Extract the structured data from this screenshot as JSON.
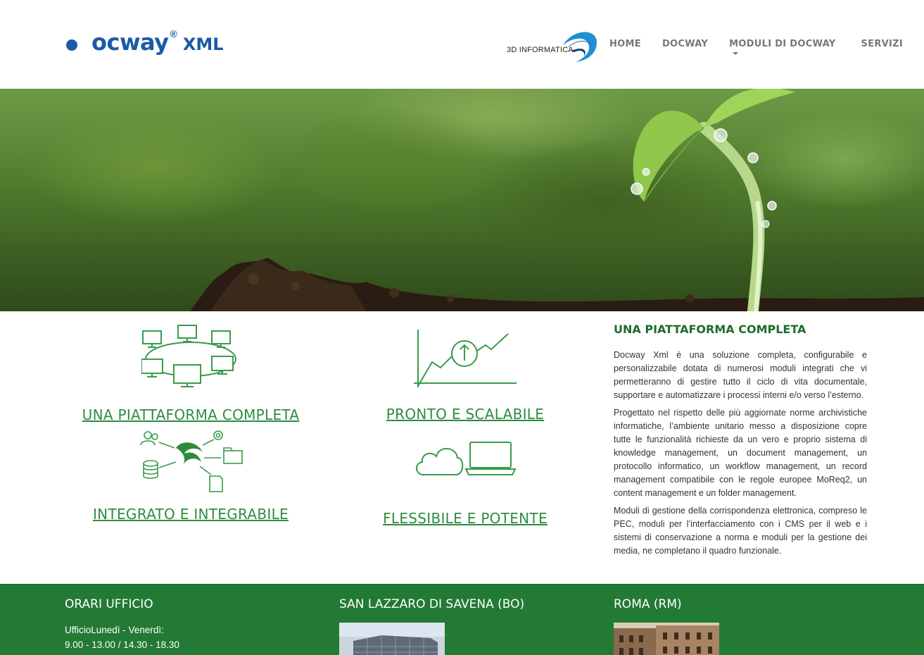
{
  "header": {
    "logo_word": "ocway",
    "logo_reg": "®",
    "logo_suffix": "XML",
    "partner_label": "3D INFORMATICA",
    "nav": [
      {
        "label": "HOME"
      },
      {
        "label": "DOCWAY"
      },
      {
        "label": "MODULI DI DOCWAY",
        "has_dropdown": true
      },
      {
        "label": "SERVIZI"
      }
    ]
  },
  "features": [
    {
      "title": "UNA PIATTAFORMA COMPLETA",
      "icon": "network-computers-icon"
    },
    {
      "title": "PRONTO E SCALABILE",
      "icon": "growth-chart-icon"
    },
    {
      "title": "INTEGRATO E INTEGRABILE",
      "icon": "integration-hub-icon"
    },
    {
      "title": "FLESSIBILE E POTENTE",
      "icon": "cloud-laptop-icon"
    }
  ],
  "side": {
    "title": "UNA PIATTAFORMA COMPLETA",
    "paragraphs": [
      "Docway Xml è una soluzione completa, configurabile e personalizzabile dotata di numerosi moduli integrati che vi permetteranno di gestire tutto il ciclo di vita documentale, supportare e automatizzare i processi interni e/o verso l’esterno.",
      "Progettato nel rispetto delle più aggiornate norme archivistiche informatiche, l’ambiente unitario messo a disposizione copre tutte le funzionalità richieste da un vero e proprio sistema di knowledge management, un document management, un protocollo informatico, un workflow management, un record management compatibile con le regole europee MoReq2, un content management e un folder management.",
      "Moduli di gestione della corrispondenza elettronica, compreso le PEC, moduli per l’interfacciamento con i CMS per il web e i sistemi di conservazione a norma e moduli per la gestione dei media, ne completano il quadro funzionale."
    ]
  },
  "footer": {
    "columns": [
      {
        "title": "ORARI UFFICIO",
        "lines": [
          "UfficioLunedì - Venerdì:",
          "9.00 - 13.00 / 14.30 - 18.30"
        ]
      },
      {
        "title": "SAN LAZZARO DI SAVENA (BO)"
      },
      {
        "title": "ROMA (RM)"
      }
    ]
  },
  "colors": {
    "brand_blue": "#1a5aa6",
    "brand_green": "#2e8b3e",
    "footer_green": "#237a35",
    "icon_green": "#3a9a4a"
  }
}
